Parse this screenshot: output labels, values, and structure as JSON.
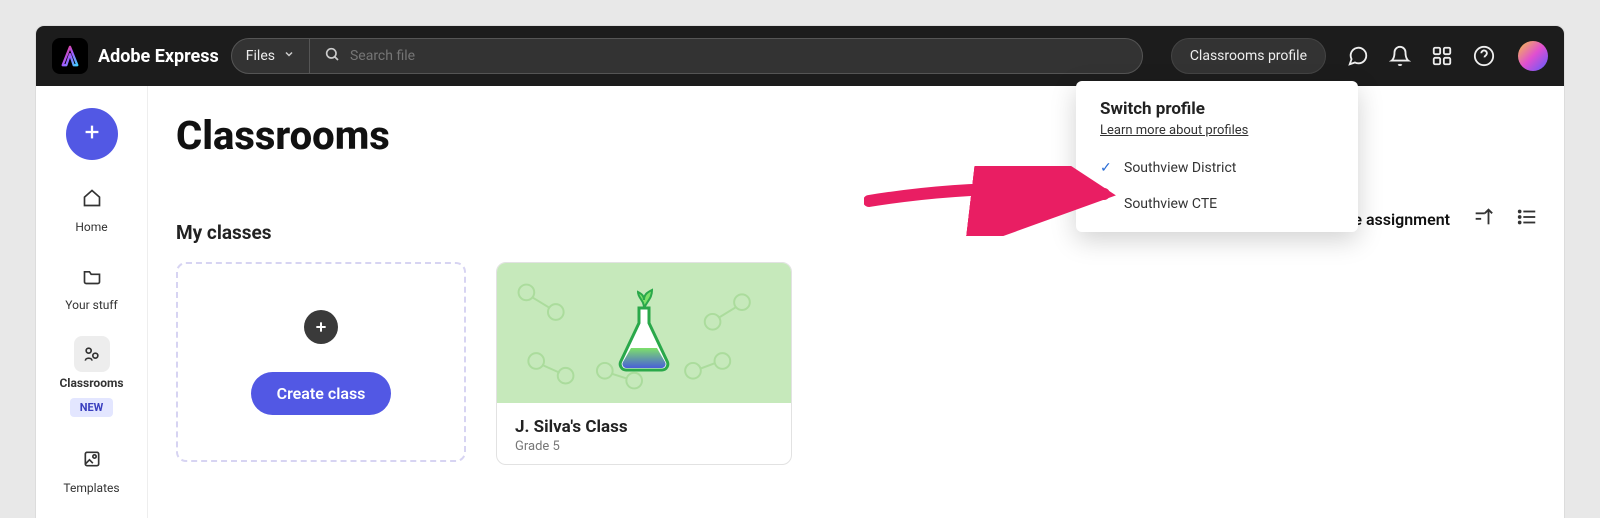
{
  "topbar": {
    "app_name": "Adobe Express",
    "files_select": "Files",
    "search_placeholder": "Search file",
    "profile_button": "Classrooms profile"
  },
  "sidebar": {
    "items": [
      {
        "label": "Home"
      },
      {
        "label": "Your stuff"
      },
      {
        "label": "Classrooms",
        "active": true,
        "badge": "NEW"
      },
      {
        "label": "Templates"
      }
    ]
  },
  "page": {
    "title": "Classrooms",
    "create_assignment": "Create assignment",
    "section_title": "My classes",
    "create_class_label": "Create class"
  },
  "classes": [
    {
      "name": "J. Silva's Class",
      "grade": "Grade 5"
    }
  ],
  "popover": {
    "title": "Switch profile",
    "learn_more": "Learn more about profiles",
    "items": [
      {
        "label": "Southview District",
        "selected": true
      },
      {
        "label": "Southview CTE",
        "selected": false
      }
    ]
  }
}
